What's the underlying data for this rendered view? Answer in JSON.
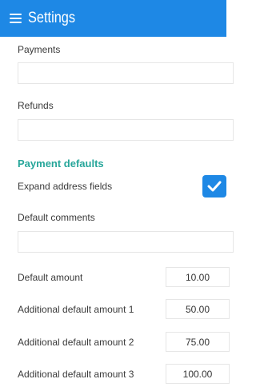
{
  "appbar": {
    "title": "Settings"
  },
  "payments": {
    "label": "Payments",
    "value": ""
  },
  "refunds": {
    "label": "Refunds",
    "value": ""
  },
  "payment_defaults": {
    "heading": "Payment defaults",
    "expand_address_fields": {
      "label": "Expand address fields",
      "checked": true
    },
    "default_comments": {
      "label": "Default comments",
      "value": ""
    },
    "default_amount": {
      "label": "Default amount",
      "value": "10.00"
    },
    "additional_amount_1": {
      "label": "Additional default amount 1",
      "value": "50.00"
    },
    "additional_amount_2": {
      "label": "Additional default amount 2",
      "value": "75.00"
    },
    "additional_amount_3": {
      "label": "Additional default amount 3",
      "value": "100.00"
    }
  },
  "colors": {
    "appbar": "#1e88e5",
    "heading": "#26a69a",
    "checkbox": "#1e88e5"
  }
}
